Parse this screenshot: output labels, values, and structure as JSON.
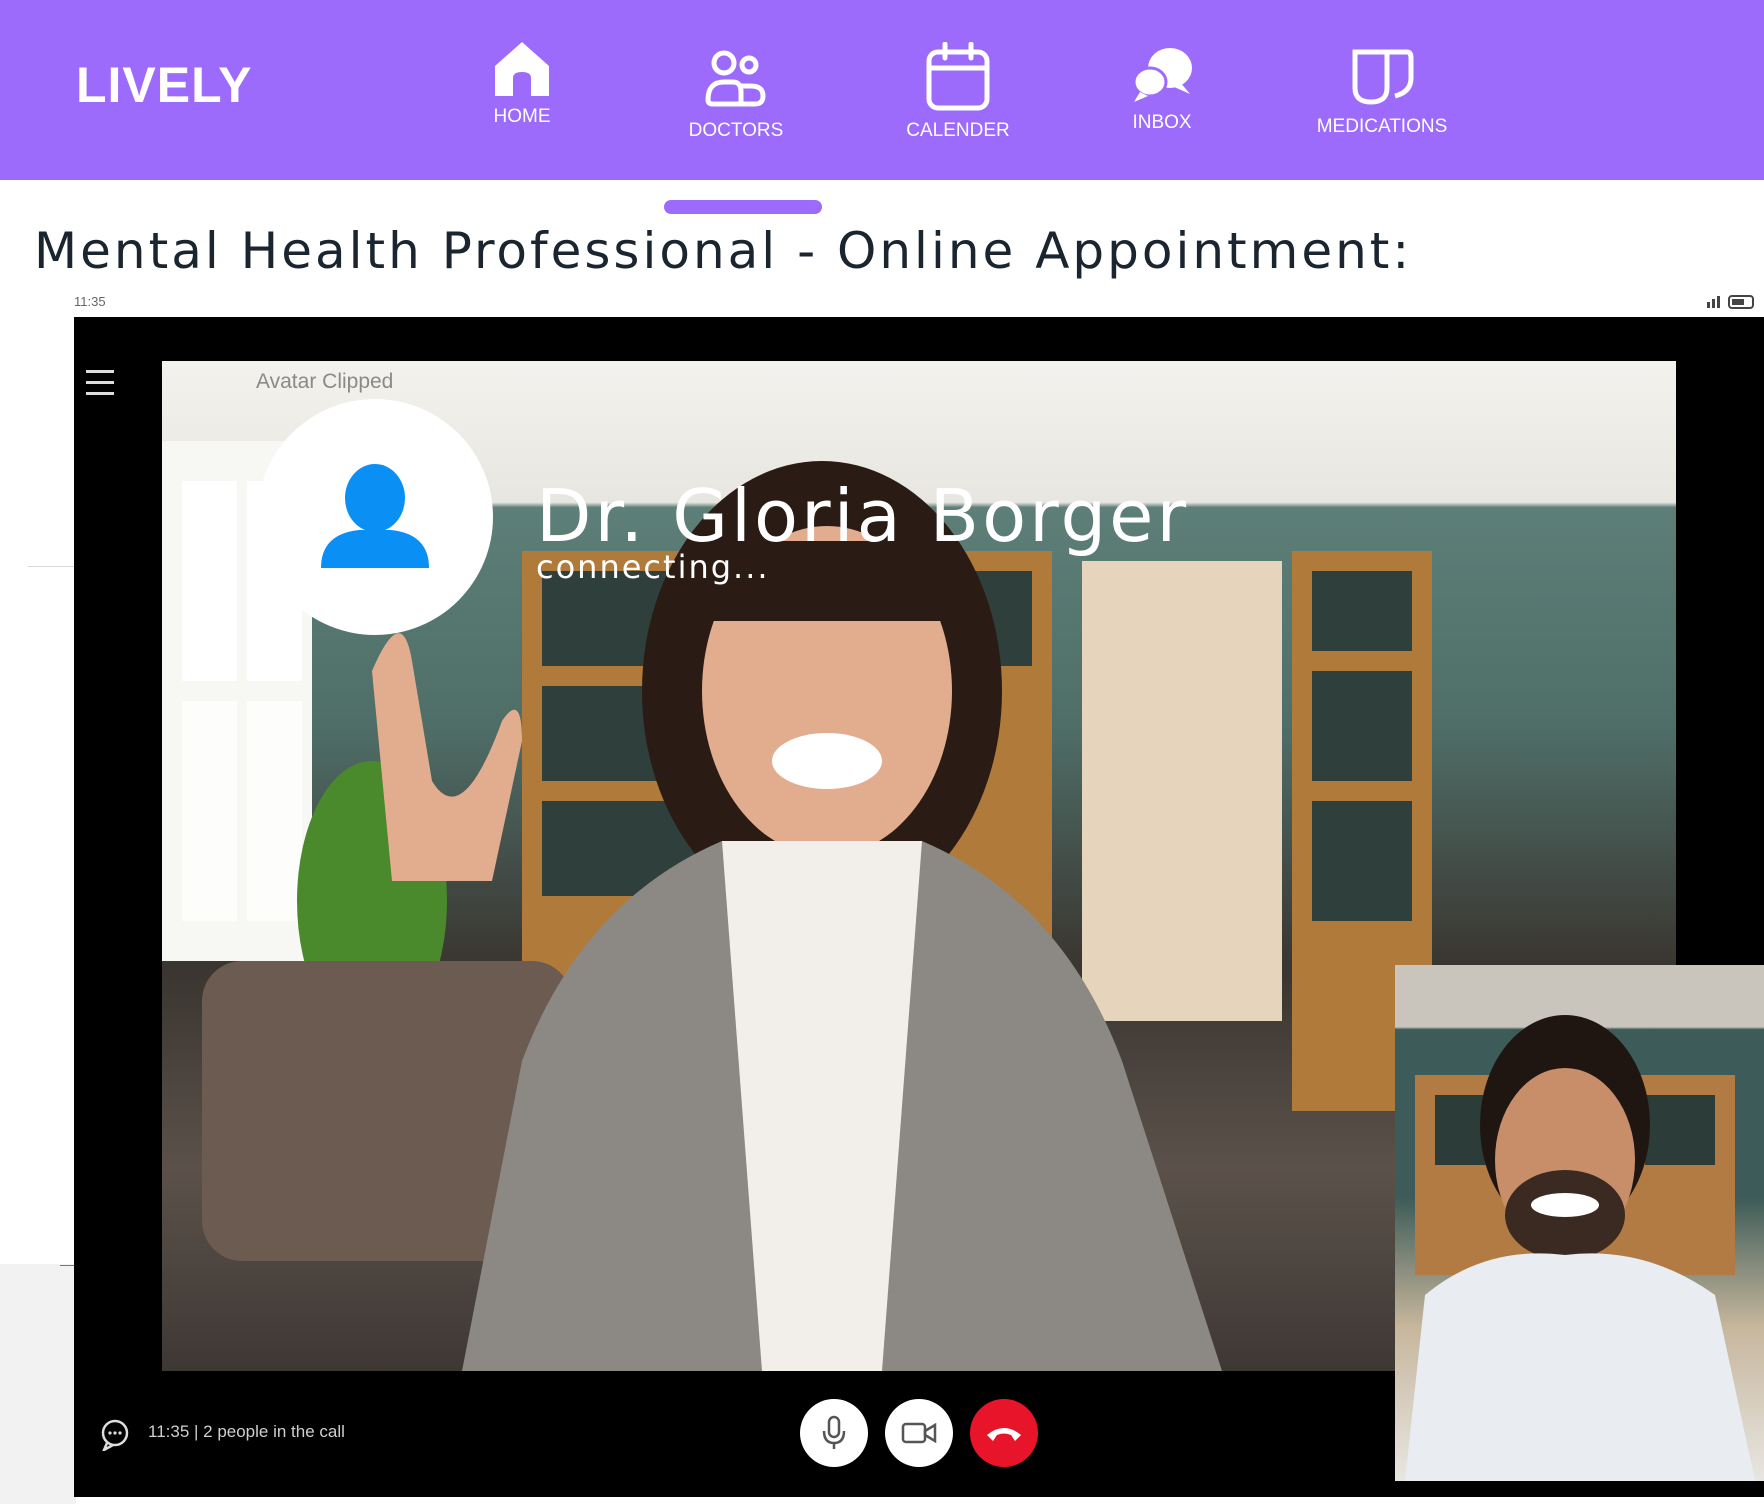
{
  "app": {
    "brand": "LIVELY"
  },
  "nav": {
    "items": [
      {
        "label": "HOME",
        "icon": "home-icon"
      },
      {
        "label": "DOCTORS",
        "icon": "doctors-icon"
      },
      {
        "label": "CALENDER",
        "icon": "calendar-icon"
      },
      {
        "label": "INBOX",
        "icon": "chat-icon"
      },
      {
        "label": "MEDICATIONS",
        "icon": "medications-icon"
      }
    ],
    "active": "DOCTORS"
  },
  "page": {
    "title": "Mental Health Professional - Online Appointment:"
  },
  "device": {
    "status_time": "11:35"
  },
  "call": {
    "avatar_label": "Avatar Clipped",
    "doctor_name": "Dr. Gloria Borger",
    "status": "connecting...",
    "info": "11:35 | 2 people in the call",
    "controls": [
      "microphone",
      "camera",
      "end-call"
    ]
  },
  "colors": {
    "brand_purple": "#9d6bfb",
    "avatar_icon_blue": "#0a8ff5",
    "end_call_red": "#e8152a",
    "title_text": "#1b2530"
  }
}
